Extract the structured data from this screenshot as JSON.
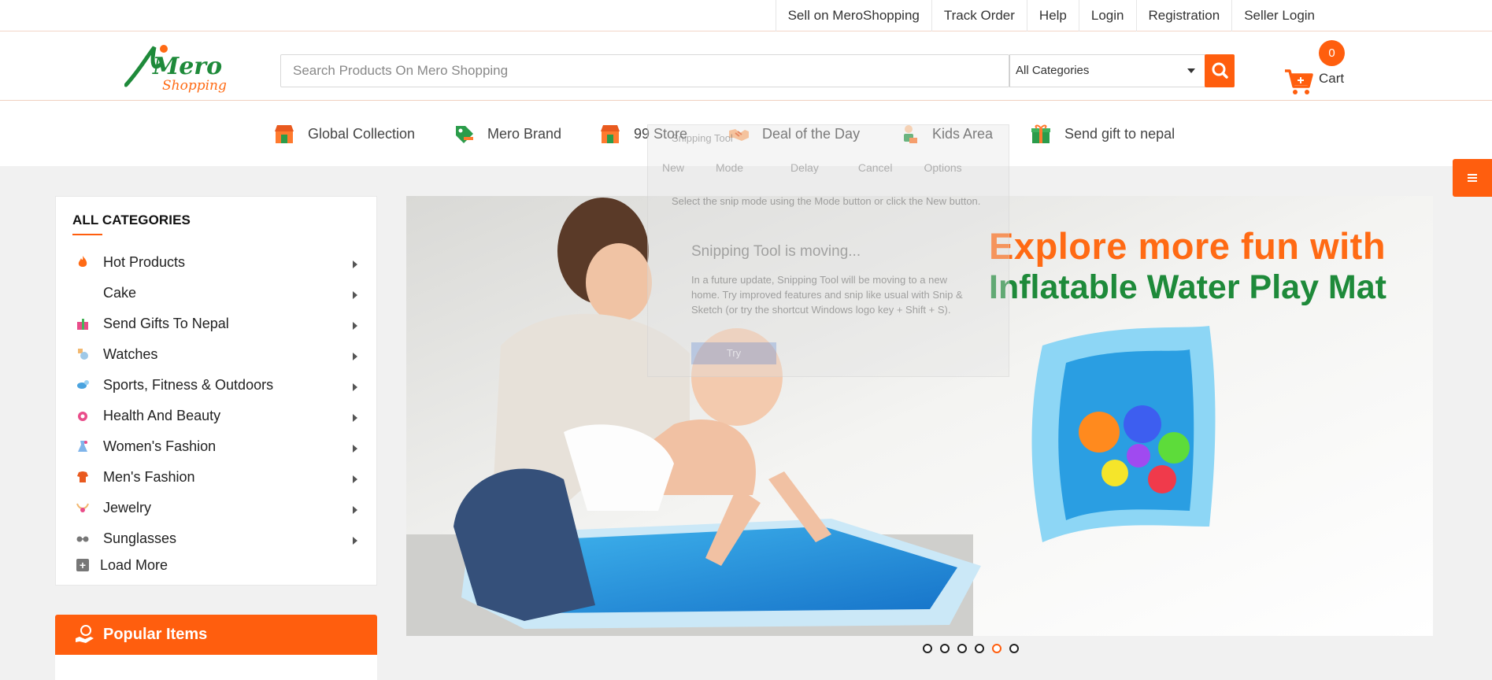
{
  "top_links": [
    "Sell on MeroShopping",
    "Track Order",
    "Help",
    "Login",
    "Registration",
    "Seller Login"
  ],
  "logo": {
    "line1": "Mero",
    "line2": "Shopping"
  },
  "search": {
    "placeholder": "Search Products On Mero Shopping",
    "category": "All Categories"
  },
  "cart": {
    "count": "0",
    "label": "Cart"
  },
  "nav": [
    "Global Collection",
    "Mero Brand",
    "99 Store",
    "Deal of the Day",
    "Kids Area",
    "Send gift to nepal"
  ],
  "categories": {
    "heading": "ALL CATEGORIES",
    "items": [
      "Hot Products",
      "Cake",
      "Send Gifts To Nepal",
      "Watches",
      "Sports, Fitness & Outdoors",
      "Health And Beauty",
      "Women's Fashion",
      "Men's Fashion",
      "Jewelry",
      "Sunglasses"
    ],
    "load_more": "Load More"
  },
  "popular": {
    "label": "Popular Items"
  },
  "banner": {
    "headline1": "Explore more fun with",
    "headline2": "Inflatable Water Play Mat",
    "slide_count": 6,
    "active_slide": 5
  },
  "snipping_tool": {
    "title": "Snipping Tool",
    "toolbar": [
      "New",
      "Mode",
      "Delay",
      "Cancel",
      "Options"
    ],
    "hint": "Select the snip mode using the Mode button or click the New button.",
    "heading": "Snipping Tool is moving...",
    "body": "In a future update, Snipping Tool will be moving to a new home. Try improved features and snip like usual with Snip & Sketch (or try the shortcut Windows logo key + Shift + S).",
    "button": "Try"
  },
  "colors": {
    "accent": "#ff5e0e",
    "green": "#1e8a3a"
  }
}
